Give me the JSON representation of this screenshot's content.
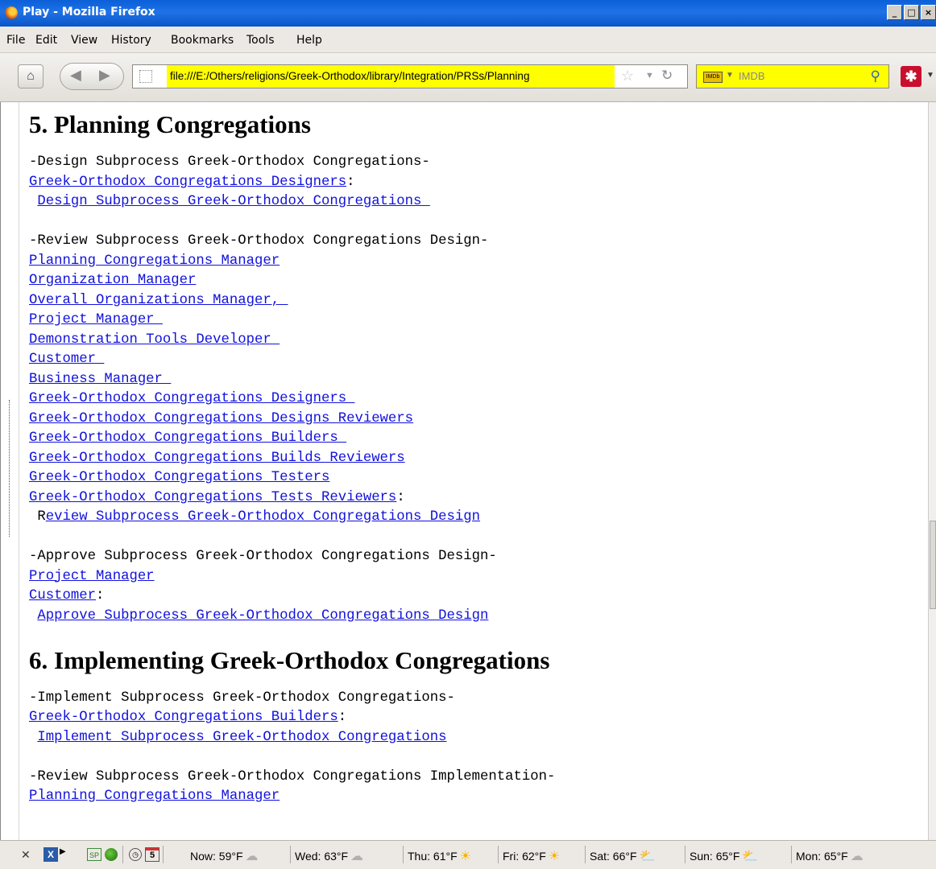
{
  "window": {
    "title": "Play - Mozilla Firefox",
    "controls": [
      "_",
      "□",
      "×"
    ]
  },
  "menu": [
    "File",
    "Edit",
    "View",
    "History",
    "Bookmarks",
    "Tools",
    "Help"
  ],
  "toolbar": {
    "url": "file:///E:/Others/religions/Greek-Orthodox/library/Integration/PRSs/Planning",
    "search_placeholder": "IMDB"
  },
  "content": {
    "sections": [
      {
        "heading": "5. Planning Congregations",
        "blocks": [
          {
            "title": "-Design Subprocess Greek-Orthodox Congregations-",
            "roles": [
              {
                "text": "Greek-Orthodox Congregations Designers",
                "suffix": ":"
              }
            ],
            "action_prefix": " ",
            "action": "Design Subprocess Greek-Orthodox Congregations "
          },
          {
            "title": "-Review Subprocess Greek-Orthodox Congregations Design-",
            "roles": [
              {
                "text": "Planning Congregations Manager",
                "suffix": ""
              },
              {
                "text": "Organization Manager",
                "suffix": ""
              },
              {
                "text": "Overall Organizations Manager, ",
                "suffix": ""
              },
              {
                "text": "Project Manager ",
                "suffix": ""
              },
              {
                "text": "Demonstration Tools Developer ",
                "suffix": ""
              },
              {
                "text": "Customer ",
                "suffix": ""
              },
              {
                "text": "Business Manager ",
                "suffix": ""
              },
              {
                "text": "Greek-Orthodox Congregations Designers ",
                "suffix": ""
              },
              {
                "text": "Greek-Orthodox Congregations Designs Reviewers",
                "suffix": ""
              },
              {
                "text": "Greek-Orthodox Congregations Builders ",
                "suffix": ""
              },
              {
                "text": "Greek-Orthodox Congregations Builds Reviewers",
                "suffix": ""
              },
              {
                "text": "Greek-Orthodox Congregations Testers",
                "suffix": ""
              },
              {
                "text": "Greek-Orthodox Congregations Tests Reviewers",
                "suffix": ":"
              }
            ],
            "action_prefix": " R",
            "action": "eview Subprocess Greek-Orthodox Congregations Design"
          },
          {
            "title": "-Approve Subprocess Greek-Orthodox Congregations Design-",
            "roles": [
              {
                "text": "Project Manager",
                "suffix": ""
              },
              {
                "text": "Customer",
                "suffix": ":"
              }
            ],
            "action_prefix": " ",
            "action": "Approve Subprocess Greek-Orthodox Congregations Design"
          }
        ]
      },
      {
        "heading": "6. Implementing Greek-Orthodox Congregations",
        "blocks": [
          {
            "title": "-Implement Subprocess Greek-Orthodox Congregations-",
            "roles": [
              {
                "text": "Greek-Orthodox Congregations Builders",
                "suffix": ":"
              }
            ],
            "action_prefix": " ",
            "action": "Implement Subprocess Greek-Orthodox Congregations"
          },
          {
            "title": "-Review Subprocess Greek-Orthodox Congregations Implementation-",
            "roles": [
              {
                "text": "Planning Congregations Manager",
                "suffix": ""
              }
            ],
            "action_prefix": "",
            "action": ""
          }
        ]
      }
    ]
  },
  "status_bar": {
    "calendar_day": "5",
    "weather": [
      {
        "label": "Now: 59°F",
        "icon": "cloud"
      },
      {
        "label": "Wed: 63°F",
        "icon": "cloud"
      },
      {
        "label": "Thu: 61°F",
        "icon": "sun"
      },
      {
        "label": "Fri: 62°F",
        "icon": "sun"
      },
      {
        "label": "Sat: 66°F",
        "icon": "partly-cloudy"
      },
      {
        "label": "Sun: 65°F",
        "icon": "partly-cloudy"
      },
      {
        "label": "Mon: 65°F",
        "icon": "cloud"
      }
    ]
  }
}
